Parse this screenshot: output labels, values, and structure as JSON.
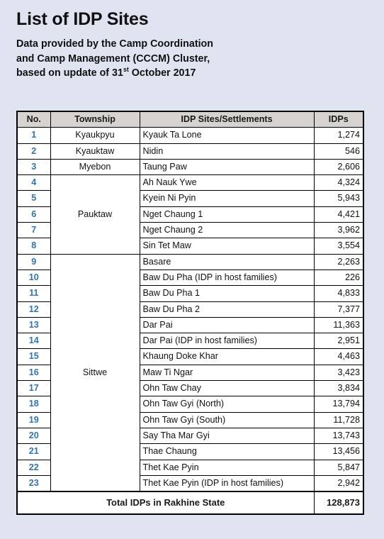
{
  "page": {
    "background_color": "#e0e4f1",
    "title": "List of IDP Sites",
    "subtitle_line1": "Data provided by the Camp Coordination",
    "subtitle_line2": "and Camp Management (CCCM) Cluster,",
    "subtitle_line3_pre": "based on update of 31",
    "subtitle_line3_sup": "st",
    "subtitle_line3_post": " October 2017"
  },
  "table": {
    "header_background": "#d7d4cf",
    "number_color": "#2e75b6",
    "columns": [
      "No.",
      "Township",
      "IDP Sites/Settlements",
      "IDPs"
    ],
    "rows": [
      {
        "no": "1",
        "township": "Kyaukpyu",
        "township_rowspan": 1,
        "site": "Kyauk Ta Lone",
        "idps": "1,274"
      },
      {
        "no": "2",
        "township": "Kyauktaw",
        "township_rowspan": 1,
        "site": "Nidin",
        "idps": "546"
      },
      {
        "no": "3",
        "township": "Myebon",
        "township_rowspan": 1,
        "site": "Taung Paw",
        "idps": "2,606"
      },
      {
        "no": "4",
        "township": "Pauktaw",
        "township_rowspan": 5,
        "site": "Ah Nauk Ywe",
        "idps": "4,324"
      },
      {
        "no": "5",
        "township": null,
        "township_rowspan": 0,
        "site": "Kyein Ni Pyin",
        "idps": "5,943"
      },
      {
        "no": "6",
        "township": null,
        "township_rowspan": 0,
        "site": "Nget Chaung 1",
        "idps": "4,421"
      },
      {
        "no": "7",
        "township": null,
        "township_rowspan": 0,
        "site": "Nget Chaung 2",
        "idps": "3,962"
      },
      {
        "no": "8",
        "township": null,
        "township_rowspan": 0,
        "site": "Sin Tet Maw",
        "idps": "3,554"
      },
      {
        "no": "9",
        "township": "Sittwe",
        "township_rowspan": 15,
        "site": "Basare",
        "idps": "2,263"
      },
      {
        "no": "10",
        "township": null,
        "township_rowspan": 0,
        "site": "Baw Du Pha (IDP in host families)",
        "idps": "226"
      },
      {
        "no": "11",
        "township": null,
        "township_rowspan": 0,
        "site": "Baw Du Pha 1",
        "idps": "4,833"
      },
      {
        "no": "12",
        "township": null,
        "township_rowspan": 0,
        "site": "Baw Du Pha 2",
        "idps": "7,377"
      },
      {
        "no": "13",
        "township": null,
        "township_rowspan": 0,
        "site": "Dar Pai",
        "idps": "11,363"
      },
      {
        "no": "14",
        "township": null,
        "township_rowspan": 0,
        "site": "Dar Pai (IDP in host families)",
        "idps": "2,951"
      },
      {
        "no": "15",
        "township": null,
        "township_rowspan": 0,
        "site": "Khaung Doke Khar",
        "idps": "4,463"
      },
      {
        "no": "16",
        "township": null,
        "township_rowspan": 0,
        "site": "Maw Ti Ngar",
        "idps": "3,423"
      },
      {
        "no": "17",
        "township": null,
        "township_rowspan": 0,
        "site": "Ohn Taw Chay",
        "idps": "3,834"
      },
      {
        "no": "18",
        "township": null,
        "township_rowspan": 0,
        "site": "Ohn Taw Gyi (North)",
        "idps": "13,794"
      },
      {
        "no": "19",
        "township": null,
        "township_rowspan": 0,
        "site": "Ohn Taw Gyi (South)",
        "idps": "11,728"
      },
      {
        "no": "20",
        "township": null,
        "township_rowspan": 0,
        "site": "Say Tha Mar Gyi",
        "idps": "13,743"
      },
      {
        "no": "21",
        "township": null,
        "township_rowspan": 0,
        "site": "Thae Chaung",
        "idps": "13,456"
      },
      {
        "no": "22",
        "township": null,
        "township_rowspan": 0,
        "site": "Thet Kae Pyin",
        "idps": "5,847"
      },
      {
        "no": "23",
        "township": null,
        "township_rowspan": 0,
        "site": "Thet Kae Pyin (IDP in host families)",
        "idps": "2,942"
      }
    ],
    "total_label": "Total IDPs in Rakhine State",
    "total_value": "128,873"
  }
}
